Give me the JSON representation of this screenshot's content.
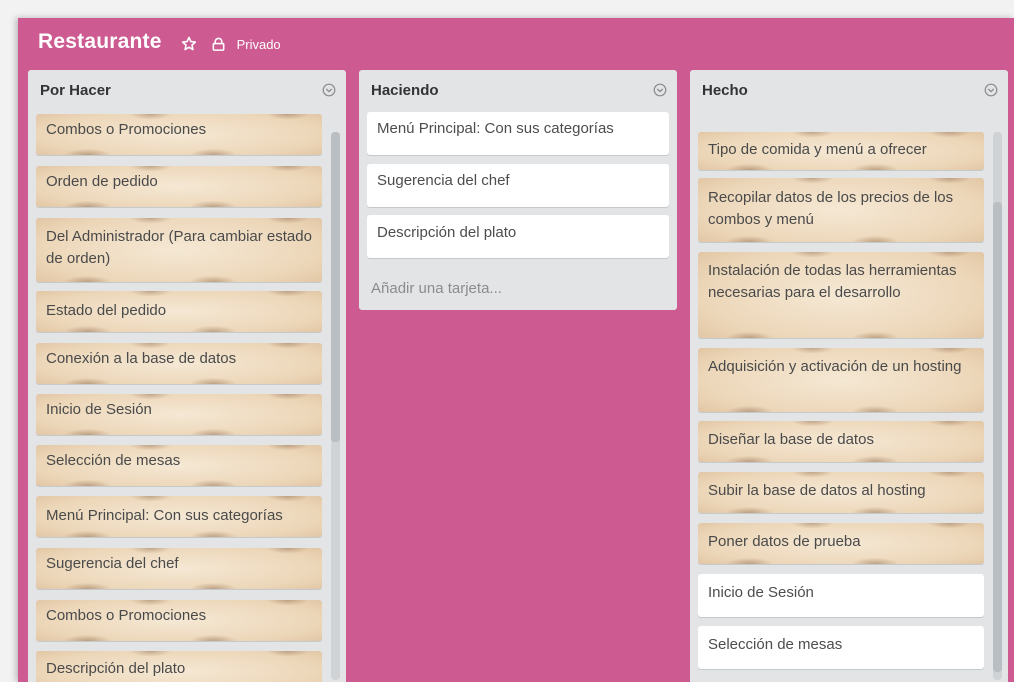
{
  "board": {
    "title": "Restaurante",
    "privacy": "Privado",
    "background_color": "#cd5a91"
  },
  "lists": [
    {
      "title": "Por Hacer",
      "cards": [
        "Combos o Promociones",
        "Orden de pedido",
        "Del Administrador (Para cambiar estado de orden)",
        "Estado del pedido",
        "Conexión a la base de datos",
        "Inicio de Sesión",
        "Selección de mesas",
        "Menú Principal: Con sus categorías",
        "Sugerencia del chef",
        "Combos o Promociones",
        "Descripción del plato"
      ]
    },
    {
      "title": "Haciendo",
      "cards": [
        "Menú Principal: Con sus categorías",
        "Sugerencia del chef",
        "Descripción del plato"
      ],
      "add_card": "Añadir una tarjeta..."
    },
    {
      "title": "Hecho",
      "cards": [
        "Tipo de comida y menú a ofrecer",
        "Recopilar datos de los precios de los combos y menú",
        "Instalación de todas las herramientas necesarias para el desarrollo",
        "Adquisición y activación de un hosting",
        "Diseñar la base de datos",
        "Subir la base de datos al hosting",
        "Poner datos de prueba",
        "Inicio de Sesión",
        "Selección de mesas"
      ]
    }
  ],
  "icons": {
    "star": "star-icon",
    "lock": "lock-icon",
    "list_menu": "chevron-circle-icon"
  }
}
